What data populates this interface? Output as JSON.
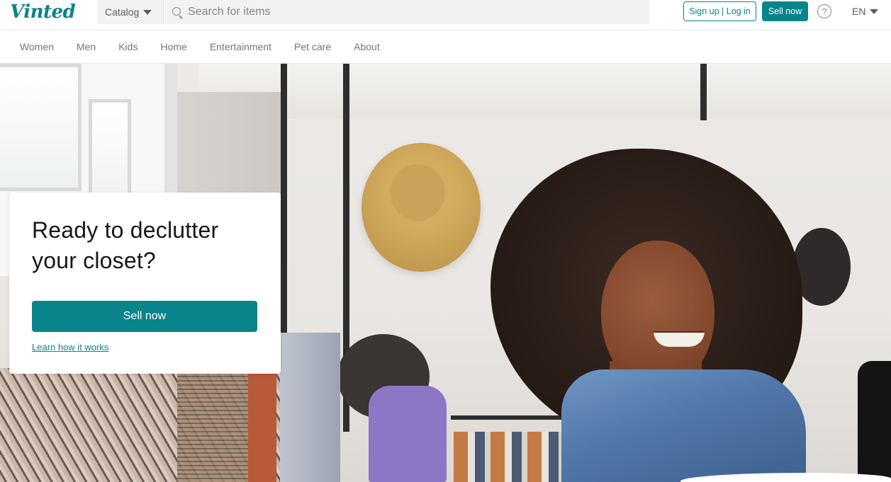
{
  "header": {
    "logo": "Vinted",
    "catalog_label": "Catalog",
    "search_placeholder": "Search for items",
    "signup_label": "Sign up | Log in",
    "sell_label": "Sell now",
    "help_glyph": "?",
    "language": "EN"
  },
  "nav": {
    "items": [
      "Women",
      "Men",
      "Kids",
      "Home",
      "Entertainment",
      "Pet care",
      "About"
    ]
  },
  "hero": {
    "title": "Ready to declutter your closet?",
    "sell_label": "Sell now",
    "learn_label": "Learn how it works"
  },
  "icons": {
    "search": "search-icon",
    "catalog_caret": "chevron-down-icon",
    "help": "help-icon",
    "language_caret": "chevron-down-icon"
  },
  "colors": {
    "brand": "#09848a",
    "text": "#171717",
    "muted": "#757575"
  }
}
